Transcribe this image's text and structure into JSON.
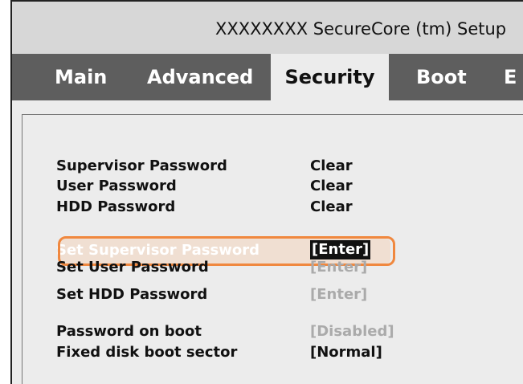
{
  "title": "XXXXXXXX SecureCore (tm) Setup",
  "tabs": [
    {
      "label": "Main",
      "active": false
    },
    {
      "label": "Advanced",
      "active": false
    },
    {
      "label": "Security",
      "active": true
    },
    {
      "label": "Boot",
      "active": false
    },
    {
      "label": "E",
      "active": false
    }
  ],
  "status": [
    {
      "label": "Supervisor Password",
      "value": "Clear"
    },
    {
      "label": "User Password",
      "value": "Clear"
    },
    {
      "label": "HDD Password",
      "value": "Clear"
    }
  ],
  "set_items": [
    {
      "label": "Set Supervisor Password",
      "value": "[Enter]",
      "selected": true
    },
    {
      "label": "Set User Password",
      "value": "[Enter]",
      "dimmed": true
    },
    {
      "label": "Set HDD Password",
      "value": "[Enter]",
      "dimmed": true
    }
  ],
  "options": [
    {
      "label": "Password on boot",
      "value": "[Disabled]",
      "dimmed": true
    },
    {
      "label": "Fixed disk boot sector",
      "value": "[Normal]",
      "dimmed": false
    }
  ],
  "colors": {
    "menubar": "#5e5e5e",
    "callout": "#f0883f",
    "panel": "#ececec"
  }
}
